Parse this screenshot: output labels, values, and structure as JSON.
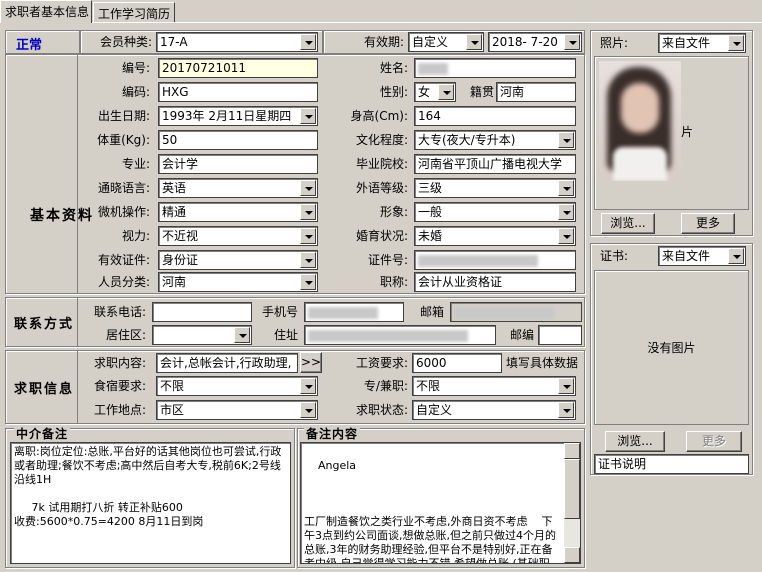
{
  "tabs": [
    "求职者基本信息",
    "工作学习简历"
  ],
  "status": "正常",
  "member_type": {
    "label": "会员种类:",
    "value": "17-A"
  },
  "validity": {
    "label": "有效期:",
    "mode": "自定义",
    "date": "2018- 7-20"
  },
  "sections": {
    "basic": "基本资料",
    "contact": "联系方式",
    "job": "求职信息"
  },
  "fields": {
    "number": {
      "label": "编号:",
      "value": "20170721011"
    },
    "name": {
      "label": "姓名:"
    },
    "code": {
      "label": "编码:",
      "value": "HXG"
    },
    "gender": {
      "label": "性别:",
      "value": "女"
    },
    "native": {
      "label": "籍贯",
      "value": "河南"
    },
    "birth": {
      "label": "出生日期:",
      "value": "1993年 2月11日星期四"
    },
    "height": {
      "label": "身高(Cm):",
      "value": "164"
    },
    "weight": {
      "label": "体重(Kg):",
      "value": "50"
    },
    "education": {
      "label": "文化程度:",
      "value": "大专(夜大/专升本)"
    },
    "major": {
      "label": "专业:",
      "value": "会计学"
    },
    "school": {
      "label": "毕业院校:",
      "value": "河南省平顶山广播电视大学"
    },
    "language": {
      "label": "通晓语言:",
      "value": "英语"
    },
    "foreign_level": {
      "label": "外语等级:",
      "value": "三级"
    },
    "computer": {
      "label": "微机操作:",
      "value": "精通"
    },
    "appearance": {
      "label": "形象:",
      "value": "一般"
    },
    "vision": {
      "label": "视力:",
      "value": "不近视"
    },
    "marital": {
      "label": "婚育状况:",
      "value": "未婚"
    },
    "id_type": {
      "label": "有效证件:",
      "value": "身份证"
    },
    "id_no": {
      "label": "证件号:"
    },
    "category": {
      "label": "人员分类:",
      "value": "河南"
    },
    "title": {
      "label": "职称:",
      "value": "会计从业资格证"
    }
  },
  "contact": {
    "phone": {
      "label": "联系电话:"
    },
    "mobile": {
      "label": "手机号"
    },
    "mail": {
      "label": "邮箱"
    },
    "district": {
      "label": "居住区:"
    },
    "address": {
      "label": "住址"
    },
    "postcode": {
      "label": "邮编"
    }
  },
  "job": {
    "content": {
      "label": "求职内容:",
      "value": "会计,总帐会计,行政助理,",
      "more": ">>"
    },
    "salary": {
      "label": "工资要求:",
      "value": "6000",
      "hint": "填写具体数据"
    },
    "board": {
      "label": "食宿要求:",
      "value": "不限"
    },
    "parttime": {
      "label": "专/兼职:",
      "value": "不限"
    },
    "location": {
      "label": "工作地点:",
      "value": "市区"
    },
    "job_status": {
      "label": "求职状态:",
      "value": "自定义"
    }
  },
  "photo": {
    "label": "照片:",
    "source": "来自文件",
    "browse": "浏览...",
    "more": "更多",
    "photo_text": "片"
  },
  "cert": {
    "label": "证书:",
    "source": "来自文件",
    "no_image": "没有图片",
    "browse": "浏览...",
    "more": "更多",
    "desc": "证书说明"
  },
  "agent_notes": {
    "title": "中介备注",
    "text": "离职:岗位定位:总账,平台好的话其他岗位也可尝试,行政或者助理;餐饮不考虑;高中然后自考大专,税前6K;2号线沿线1H\n\n     7k 试用期打八折 转正补贴600\n收费:5600*0.75=4200 8月11日到岗"
  },
  "remarks": {
    "title": "备注内容",
    "text": "Angela\n\n\n\n工厂制造餐饮之类行业不考虑,外商日资不考虑    下午3点到约公司面谈,想做总账,但之前只做过4个月的总账,3年的财务助理经验,但平台不是特别好,正在备考中级,自己觉得学习能力不错,希望做总账,(基础职位也可以接受,"
  }
}
